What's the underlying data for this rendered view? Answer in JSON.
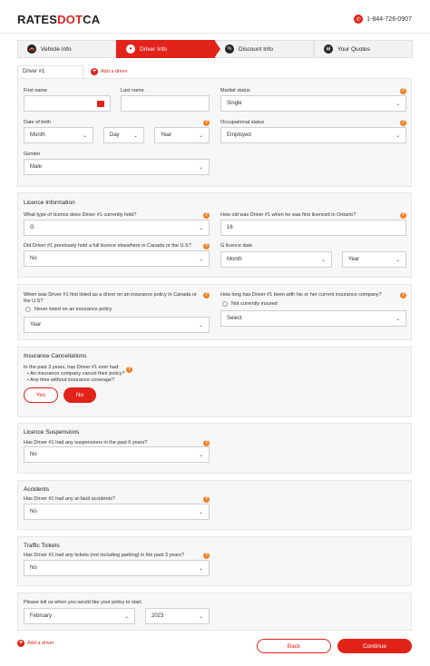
{
  "header": {
    "logo_a": "RATES",
    "logo_b": "DOT",
    "logo_c": "CA",
    "phone": "1-844-726-0907"
  },
  "steps": [
    {
      "label": "Vehicle Info",
      "icon": "car-icon"
    },
    {
      "label": "Driver Info",
      "icon": "person-icon"
    },
    {
      "label": "Discount Info",
      "icon": "discount-icon"
    },
    {
      "label": "Your Quotes",
      "icon": "document-icon"
    }
  ],
  "tabs": {
    "driver": "Driver #1",
    "add": "Add a driver"
  },
  "personal": {
    "first_name": "First name",
    "last_name": "Last name",
    "marital": "Marital status",
    "marital_value": "Single",
    "dob": "Date of birth",
    "month": "Month",
    "day": "Day",
    "year": "Year",
    "occupation": "Occupational status",
    "occupation_value": "Employed",
    "gender": "Gender",
    "gender_value": "Male"
  },
  "licence": {
    "title": "Licence Information",
    "type_q": "What type of licence does Driver #1 currently hold?",
    "type_value": "G",
    "age_q": "How old was Driver #1 when he was first licenced in Ontario?",
    "age_value": "16",
    "elsewhere_q": "Did Driver #1 previously hold a full licence elsewhere in Canada or the U.S?",
    "elsewhere_value": "No",
    "g_date": "G licence date",
    "month": "Month",
    "year": "Year"
  },
  "insured": {
    "first_q": "When was Driver #1 first listed as a driver on an insurance policy in Canada or the U.S?",
    "never": "Never listed on an insurance policy",
    "year": "Year",
    "how_long_q": "How long has Driver #1 been with his or her current insurance company?",
    "not_insured": "Not currently insured",
    "select": "Select"
  },
  "cancellations": {
    "title": "Insurance Cancellations",
    "q": "In the past 3 years, has Driver #1 ever had:",
    "b1": "• An insurance company cancel their policy?",
    "b2": "• Any time without insurance coverage?",
    "yes": "Yes",
    "no": "No"
  },
  "suspensions": {
    "title": "Licence Suspensions",
    "q": "Has Driver #1 had any suspensions in the past 6 years?",
    "value": "No"
  },
  "accidents": {
    "title": "Accidents",
    "q": "Has Driver #1 had any at-fault accidents?",
    "value": "No"
  },
  "tickets": {
    "title": "Traffic Tickets",
    "q": "Has Driver #1 had any tickets (not including parking) in the past 3 years?",
    "value": "No"
  },
  "start": {
    "q": "Please tell us when you would like your policy to start.",
    "month": "February",
    "year": "2023"
  },
  "footer": {
    "add": "Add a driver",
    "back": "Back",
    "continue": "Continue"
  },
  "colors": {
    "brand": "#e2231a",
    "help": "#f0822a"
  }
}
